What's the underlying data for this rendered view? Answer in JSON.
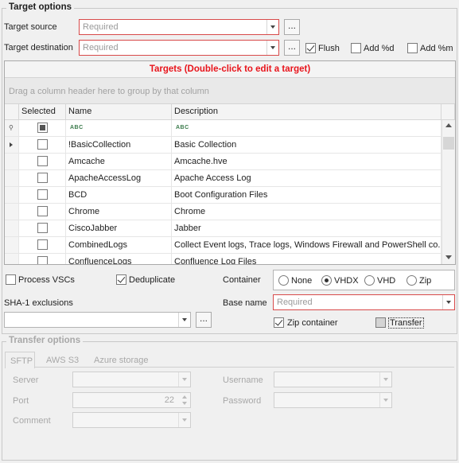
{
  "target_options": {
    "title": "Target options",
    "target_source_label": "Target source",
    "target_source_placeholder": "Required",
    "target_destination_label": "Target destination",
    "target_destination_placeholder": "Required",
    "browse_label": "...",
    "flush_label": "Flush",
    "add_d_label": "Add %d",
    "add_m_label": "Add %m"
  },
  "targets_grid": {
    "caption": "Targets (Double-click to edit a target)",
    "group_panel_text": "Drag a column header here to group by that column",
    "columns": [
      "Selected",
      "Name",
      "Description"
    ],
    "filter_abc": "ABC",
    "rows": [
      {
        "name": "!BasicCollection",
        "description": "Basic Collection"
      },
      {
        "name": "Amcache",
        "description": "Amcache.hve"
      },
      {
        "name": "ApacheAccessLog",
        "description": "Apache Access Log"
      },
      {
        "name": "BCD",
        "description": "Boot Configuration Files"
      },
      {
        "name": "Chrome",
        "description": "Chrome"
      },
      {
        "name": "CiscoJabber",
        "description": "Jabber"
      },
      {
        "name": "CombinedLogs",
        "description": "Collect Event logs, Trace logs, Windows Firewall and PowerShell co..."
      },
      {
        "name": "ConfluenceLogs",
        "description": "Confluence Log Files"
      }
    ]
  },
  "options": {
    "process_vscs_label": "Process VSCs",
    "deduplicate_label": "Deduplicate",
    "container_label": "Container",
    "container_options": [
      "None",
      "VHDX",
      "VHD",
      "Zip"
    ],
    "container_selected": "VHDX",
    "sha1_label": "SHA-1 exclusions",
    "base_name_label": "Base name",
    "base_name_placeholder": "Required",
    "zip_container_label": "Zip container",
    "transfer_label": "Transfer"
  },
  "transfer_options": {
    "title": "Transfer options",
    "tabs": [
      "SFTP",
      "AWS S3",
      "Azure storage"
    ],
    "server_label": "Server",
    "port_label": "Port",
    "port_value": "22",
    "comment_label": "Comment",
    "username_label": "Username",
    "password_label": "Password"
  }
}
